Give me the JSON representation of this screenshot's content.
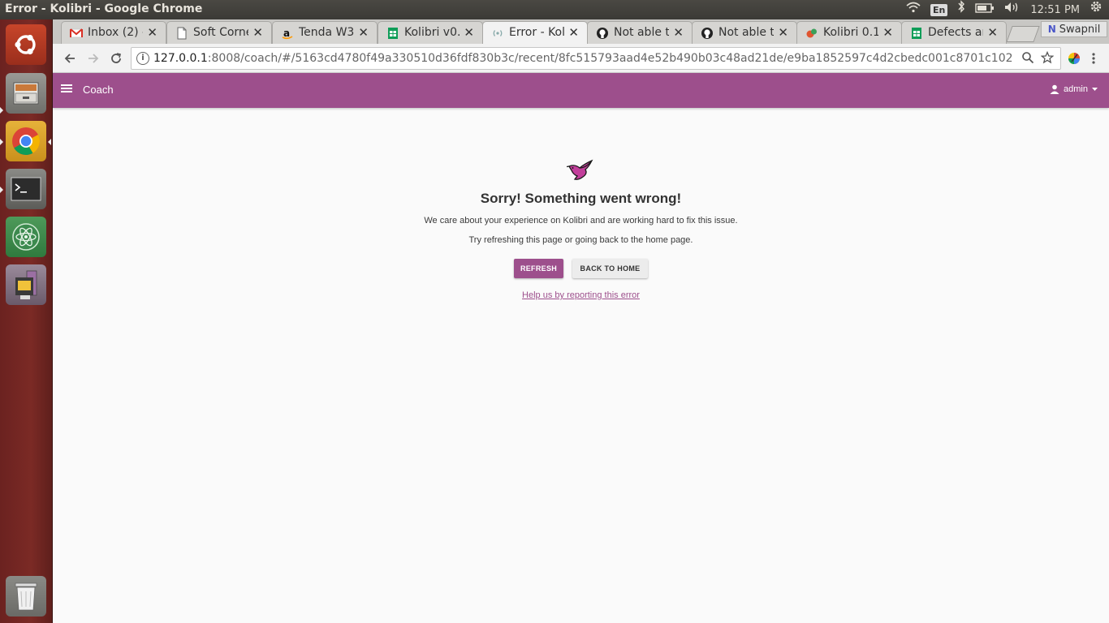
{
  "window": {
    "title": "Error - Kolibri - Google Chrome"
  },
  "system_tray": {
    "keyboard": "En",
    "time": "12:51 PM"
  },
  "launcher": {
    "items": [
      {
        "name": "ubuntu-dash",
        "icon": "ubuntu-logo-icon"
      },
      {
        "name": "files",
        "icon": "file-cabinet-icon"
      },
      {
        "name": "chrome",
        "icon": "chrome-icon"
      },
      {
        "name": "terminal",
        "icon": "terminal-icon"
      },
      {
        "name": "atom",
        "icon": "atom-icon"
      },
      {
        "name": "usb-creator",
        "icon": "usb-icon"
      },
      {
        "name": "trash",
        "icon": "trash-icon"
      }
    ]
  },
  "tabs": [
    {
      "label": "Inbox (2) - ",
      "icon": "gmail-icon",
      "active": false
    },
    {
      "label": "Soft Corne",
      "icon": "page-icon",
      "active": false
    },
    {
      "label": "Tenda W3",
      "icon": "amazon-icon",
      "active": false
    },
    {
      "label": "Kolibri v0.",
      "icon": "sheets-icon",
      "active": false
    },
    {
      "label": "Error - Kol",
      "icon": "loading-icon",
      "active": true
    },
    {
      "label": "Not able t",
      "icon": "github-icon",
      "active": false
    },
    {
      "label": "Not able t",
      "icon": "github-icon",
      "active": false
    },
    {
      "label": "Kolibri 0.1",
      "icon": "kolibri-icon",
      "active": false
    },
    {
      "label": "Defects ar",
      "icon": "sheets-icon",
      "active": false
    }
  ],
  "profile": {
    "name": "Swapnil"
  },
  "address_bar": {
    "host": "127.0.0.1",
    "rest": ":8008/coach/#/5163cd4780f49a330510d36fdf830b3c/recent/8fc515793aad4e52b490b03c48ad21de/e9ba1852597c4d2cbedc001c8701c102"
  },
  "app_bar": {
    "title": "Coach",
    "user": "admin"
  },
  "error_page": {
    "heading": "Sorry! Something went wrong!",
    "line1": "We care about your experience on Kolibri and are working hard to fix this issue.",
    "line2": "Try refreshing this page or going back to the home page.",
    "refresh_label": "REFRESH",
    "home_label": "BACK TO HOME",
    "report_link": "Help us by reporting this error"
  },
  "colors": {
    "brand": "#9d4f8c",
    "launcher": "#7b2a25",
    "panel": "#3b3a36"
  }
}
